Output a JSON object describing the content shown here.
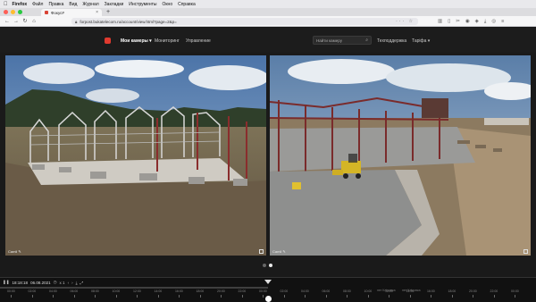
{
  "menubar": {
    "items": [
      "Firefox",
      "Файл",
      "Правка",
      "Вид",
      "Журнал",
      "Закладки",
      "Инструменты",
      "Окно",
      "Справка"
    ]
  },
  "browser": {
    "tab_title": "Фокус#",
    "url": "forpost.bukatelecom.ru/account/view.html?page=2&p="
  },
  "app": {
    "nav": {
      "my_cameras": "Мои камеры",
      "monitoring": "Мониторинг",
      "management": "Управление",
      "tech_support": "Техподдержка",
      "tariff": "Тарiфа"
    },
    "search_placeholder": "Найти камеру"
  },
  "cameras": [
    {
      "label": "Camli"
    },
    {
      "label": "Camli"
    }
  ],
  "timeline": {
    "time": "18:18:18",
    "date": "06.08.2021",
    "speed": "x 1",
    "ticks": [
      "00:00",
      "02:00",
      "04:00",
      "06:00",
      "08:00",
      "10:00",
      "12:00",
      "14:00",
      "16:00",
      "18:00",
      "20:00",
      "22:00",
      "00:00",
      "02:00",
      "04:00",
      "06:00",
      "08:00",
      "10:00",
      "12:00",
      "14:00",
      "16:00",
      "18:00",
      "20:00",
      "22:00",
      "00:00"
    ],
    "note_left": "нет Клiцовка",
    "note_right": "нет Клiцовка"
  },
  "colors": {
    "accent": "#e03a2f",
    "header_bg": "#1c1c1c",
    "page_bg": "#1a1a1a"
  }
}
